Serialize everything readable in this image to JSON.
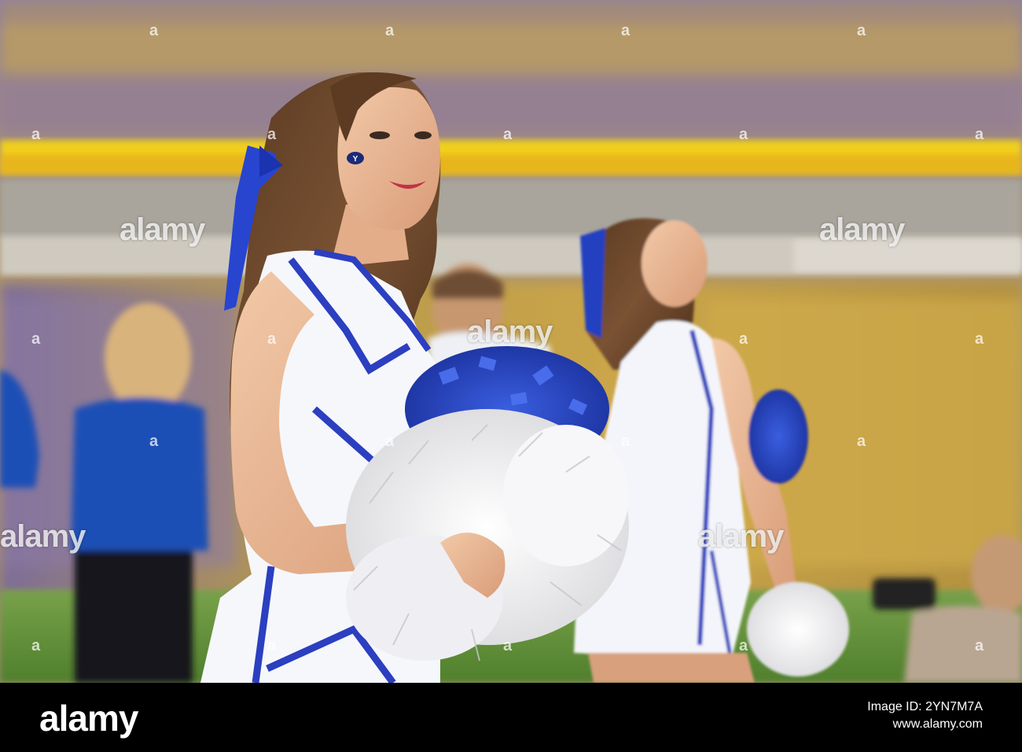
{
  "watermark": {
    "brand": "alamy",
    "repeated_mark": "a"
  },
  "footer": {
    "logo": "alamy",
    "image_id_label": "Image ID: 2YN7M7A",
    "site": "www.alamy.com"
  },
  "scene": {
    "cheek_logo": "Y"
  },
  "colors": {
    "uniform_blue": "#1f3fbf",
    "crowd_gold": "#c9a23e",
    "crowd_purple": "#6b5a9c",
    "field_green": "#5f8f3a",
    "banner_yellow": "#f2d21d"
  }
}
